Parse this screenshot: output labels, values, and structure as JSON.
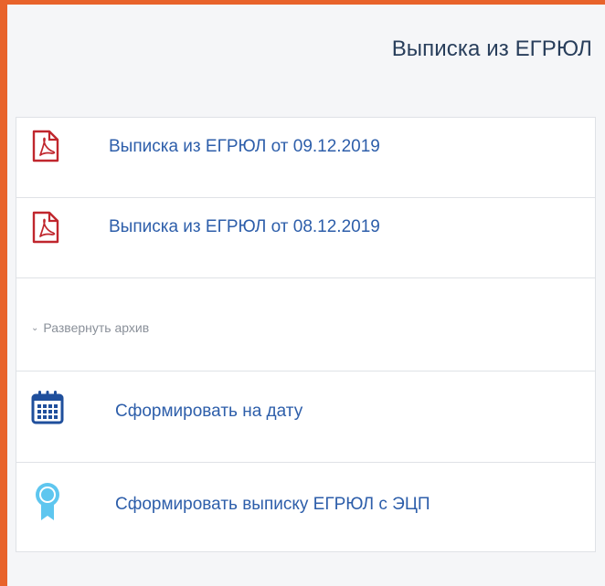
{
  "panel": {
    "title": "Выписка из ЕГРЮЛ"
  },
  "documents": [
    {
      "label": "Выписка из ЕГРЮЛ от 09.12.2019",
      "icon": "pdf-icon"
    },
    {
      "label": "Выписка из ЕГРЮЛ от 08.12.2019",
      "icon": "pdf-icon"
    }
  ],
  "archive": {
    "label": "Развернуть архив",
    "icon": "chevron-down-icon"
  },
  "actions": {
    "form_on_date": {
      "label": "Сформировать на дату",
      "icon": "calendar-icon"
    },
    "form_with_ecp": {
      "label": "Сформировать выписку ЕГРЮЛ с ЭЦП",
      "icon": "badge-ribbon-icon"
    }
  },
  "colors": {
    "frame": "#e8632b",
    "title": "#283e5b",
    "link": "#2d5eaa",
    "pdf_red": "#c0262d",
    "calendar_blue": "#1f4f9c",
    "badge_blue": "#5ec6ef",
    "muted": "#8a9099"
  }
}
